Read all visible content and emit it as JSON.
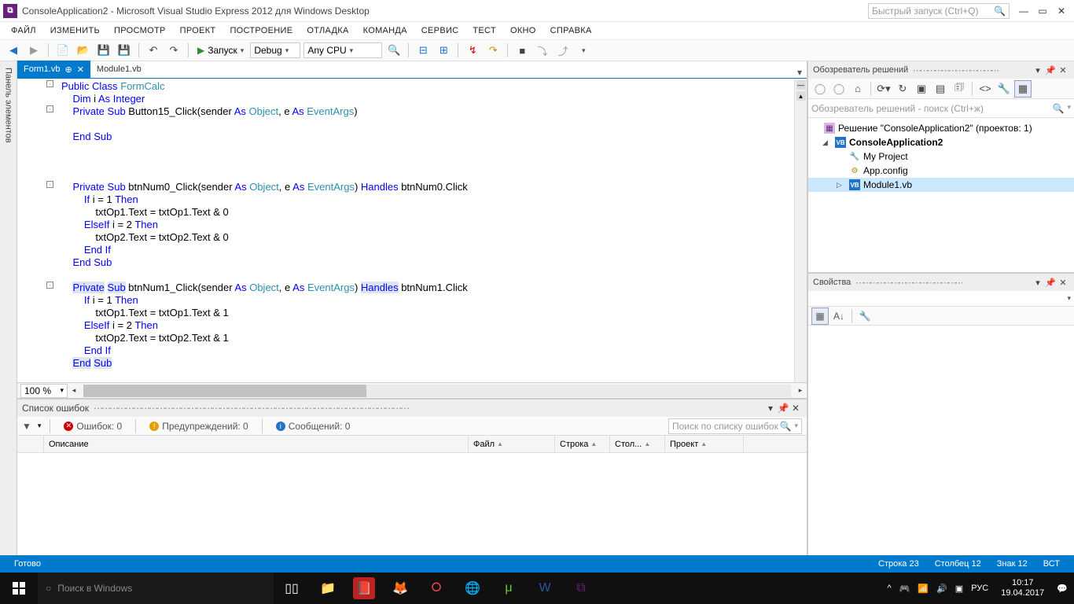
{
  "titlebar": {
    "title": "ConsoleApplication2 - Microsoft Visual Studio Express 2012 для Windows Desktop",
    "quick_launch_placeholder": "Быстрый запуск (Ctrl+Q)"
  },
  "menu": [
    "ФАЙЛ",
    "ИЗМЕНИТЬ",
    "ПРОСМОТР",
    "ПРОЕКТ",
    "ПОСТРОЕНИЕ",
    "ОТЛАДКА",
    "КОМАНДА",
    "СЕРВИС",
    "ТЕСТ",
    "ОКНО",
    "СПРАВКА"
  ],
  "toolbar": {
    "start_label": "Запуск",
    "config": "Debug",
    "platform": "Any CPU"
  },
  "left_panel_title": "Панель элементов",
  "tabs": {
    "active": "Form1.vb",
    "inactive": "Module1.vb"
  },
  "zoom": "100 %",
  "code": {
    "lines": [
      {
        "fold": "-",
        "html": "<span class='kw'>Public</span> <span class='kw'>Class</span> <span class='type'>FormCalc</span>"
      },
      {
        "html": "    <span class='kw'>Dim</span> i <span class='kw'>As</span> <span class='kw'>Integer</span>"
      },
      {
        "fold": "-",
        "html": "    <span class='kw'>Private</span> <span class='kw'>Sub</span> Button15_Click(sender <span class='kw'>As</span> <span class='type'>Object</span>, e <span class='kw'>As</span> <span class='type'>EventArgs</span>)"
      },
      {
        "html": ""
      },
      {
        "html": "    <span class='kw'>End</span> <span class='kw'>Sub</span>"
      },
      {
        "html": ""
      },
      {
        "html": ""
      },
      {
        "html": ""
      },
      {
        "fold": "-",
        "html": "    <span class='kw'>Private</span> <span class='kw'>Sub</span> btnNum0_Click(sender <span class='kw'>As</span> <span class='type'>Object</span>, e <span class='kw'>As</span> <span class='type'>EventArgs</span>) <span class='kw'>Handles</span> btnNum0.Click"
      },
      {
        "html": "        <span class='kw'>If</span> i = 1 <span class='kw'>Then</span>"
      },
      {
        "html": "            txtOp1.Text = txtOp1.Text &amp; 0"
      },
      {
        "html": "        <span class='kw'>ElseIf</span> i = 2 <span class='kw'>Then</span>"
      },
      {
        "html": "            txtOp2.Text = txtOp2.Text &amp; 0"
      },
      {
        "html": "        <span class='kw'>End</span> <span class='kw'>If</span>"
      },
      {
        "html": "    <span class='kw'>End</span> <span class='kw'>Sub</span>"
      },
      {
        "html": ""
      },
      {
        "fold": "-",
        "html": "    <span class='kw tok-hi'>Private</span> <span class='kw tok-hi'>Sub</span> btnNum1_Click(sender <span class='kw'>As</span> <span class='type'>Object</span>, e <span class='kw'>As</span> <span class='type'>EventArgs</span>) <span class='kw tok-hi'>Handles</span> btnNum1.Click"
      },
      {
        "html": "        <span class='kw'>If</span> i = 1 <span class='kw'>Then</span>"
      },
      {
        "html": "            txtOp1.Text = txtOp1.Text &amp; 1"
      },
      {
        "html": "        <span class='kw'>ElseIf</span> i = 2 <span class='kw'>Then</span>"
      },
      {
        "html": "            txtOp2.Text = txtOp2.Text &amp; 1"
      },
      {
        "html": "        <span class='kw'>End</span> <span class='kw'>If</span>"
      },
      {
        "html": "    <span class='kw tok-hi'>End</span> <span class='kw tok-hi'>Sub</span>"
      }
    ]
  },
  "error_panel": {
    "title": "Список ошибок",
    "errors": "Ошибок: 0",
    "warnings": "Предупреждений: 0",
    "messages": "Сообщений: 0",
    "search_placeholder": "Поиск по списку ошибок",
    "columns": [
      "",
      "Описание",
      "Файл",
      "Строка",
      "Стол...",
      "Проект"
    ]
  },
  "solution": {
    "panel_title": "Обозреватель решений",
    "search_placeholder": "Обозреватель решений - поиск (Ctrl+ж)",
    "root": "Решение \"ConsoleApplication2\" (проектов: 1)",
    "project": "ConsoleApplication2",
    "items": [
      {
        "icon": "wrench",
        "label": "My Project"
      },
      {
        "icon": "cfg",
        "label": "App.config"
      },
      {
        "icon": "vb",
        "label": "Module1.vb",
        "sel": true,
        "expandable": true
      }
    ],
    "vb_badge": "VB"
  },
  "properties": {
    "panel_title": "Свойства"
  },
  "status": {
    "ready": "Готово",
    "line": "Строка 23",
    "col": "Столбец 12",
    "char": "Знак 12",
    "ins": "ВСТ"
  },
  "taskbar": {
    "search_placeholder": "Поиск в Windows",
    "lang": "РУС",
    "time": "10:17",
    "date": "19.04.2017"
  }
}
